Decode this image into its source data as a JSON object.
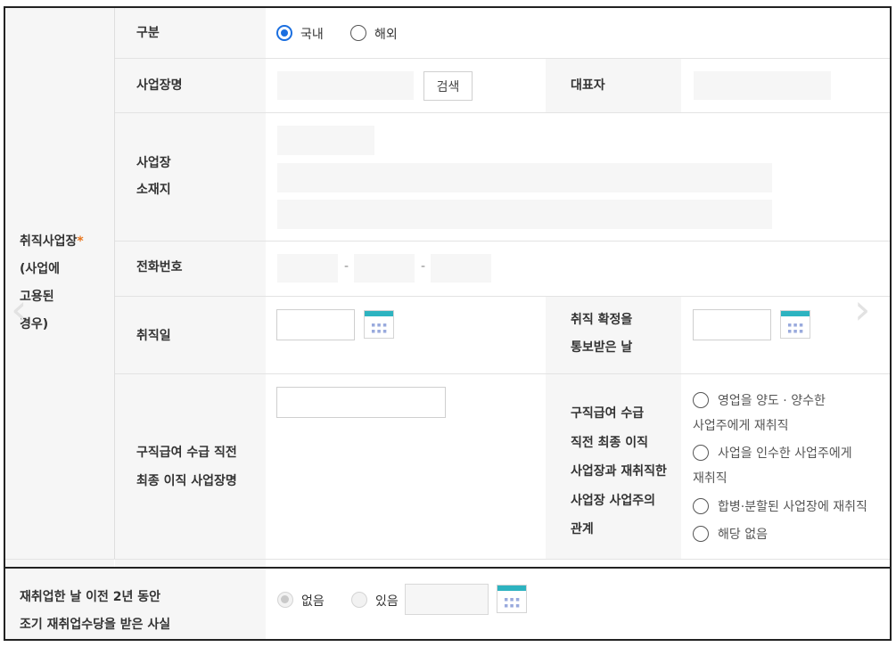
{
  "section": {
    "label_line1": "취직사업장",
    "required_mark": "*",
    "label_line2": "(사업에",
    "label_line3": "고용된",
    "label_line4": "경우)"
  },
  "type_row": {
    "label": "구분",
    "options": [
      {
        "label": "국내",
        "checked": true
      },
      {
        "label": "해외",
        "checked": false
      }
    ]
  },
  "workplace_row": {
    "label": "사업장명",
    "search_button": "검색",
    "representative_label": "대표자"
  },
  "address_row": {
    "label_line1": "사업장",
    "label_line2": "소재지"
  },
  "phone_row": {
    "label": "전화번호",
    "separator": "-"
  },
  "employment_date_row": {
    "label": "취직일",
    "notified_label_line1": "취직 확정을",
    "notified_label_line2": "통보받은 날"
  },
  "last_workplace_row": {
    "label_line1": "구직급여 수급 직전",
    "label_line2": "최종 이직 사업장명",
    "relation_label_lines": [
      "구직급여 수급",
      "직전 최종 이직",
      "사업장과 재취직한",
      "사업장 사업주의",
      "관계"
    ],
    "relation_options": [
      {
        "line1": "영업을 양도 · 양수한",
        "line2": "사업주에게 재취직"
      },
      {
        "line1": "사업을 인수한 사업주에게",
        "line2": "재취직"
      },
      {
        "line1": "합병·분할된 사업장에 재취직",
        "line2": ""
      },
      {
        "line1": "해당 없음",
        "line2": ""
      }
    ]
  },
  "early_reemployment": {
    "label_line1": "재취업한 날 이전 2년 동안",
    "label_line2": "조기 재취업수당을 받은 사실",
    "options": [
      {
        "label": "없음",
        "checked": true,
        "disabled": true
      },
      {
        "label": "있음",
        "checked": false,
        "disabled": true
      }
    ]
  },
  "icons": {
    "calendar": "calendar-icon",
    "prev": "chevron-left-icon",
    "next": "chevron-right-icon"
  },
  "colors": {
    "accent": "#1b6fe0",
    "required": "#e8741b",
    "calendar": "#2db3c0"
  }
}
